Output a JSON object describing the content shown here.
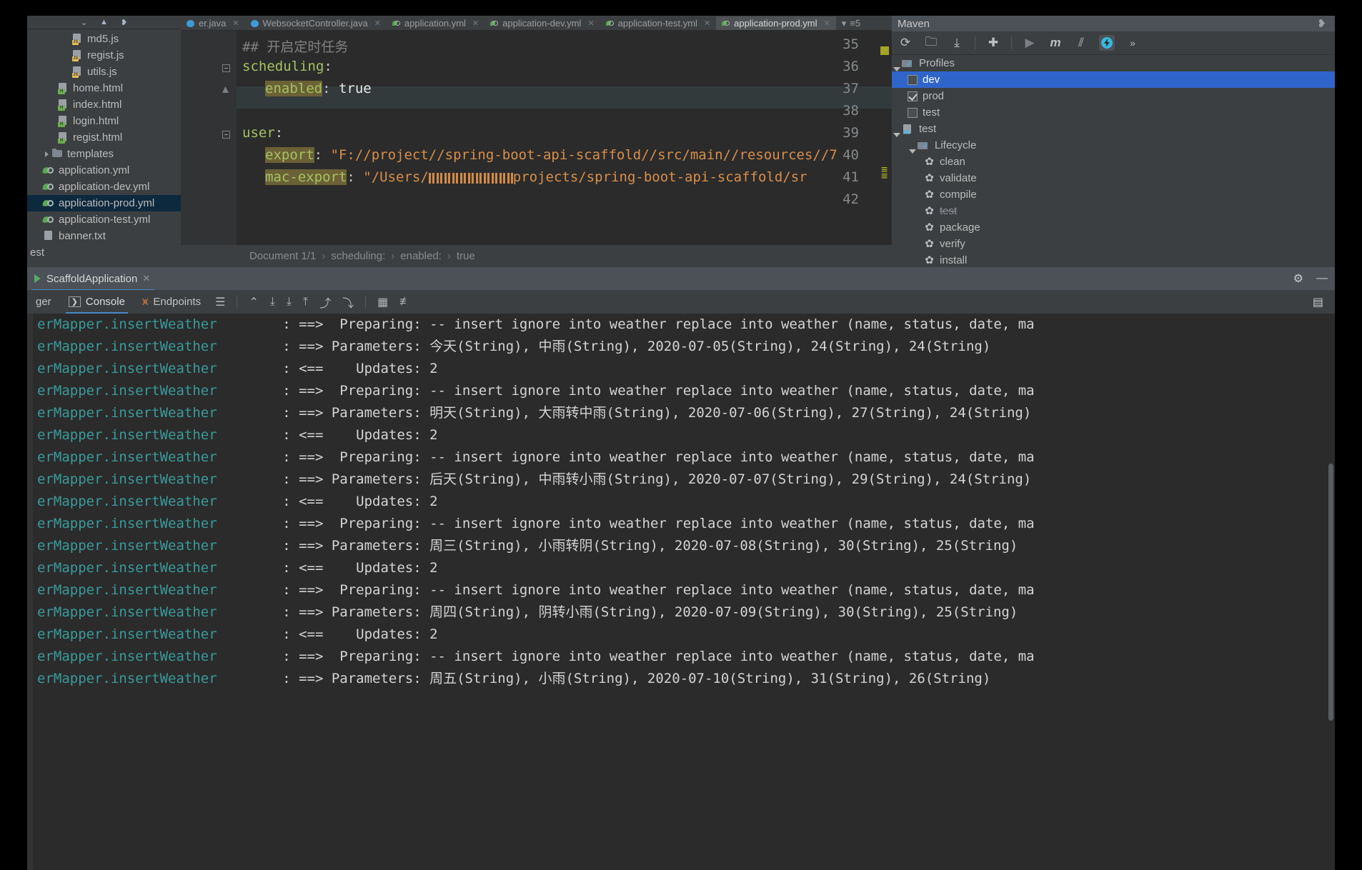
{
  "project_tree": {
    "items": [
      {
        "label": "md5.js",
        "icon": "js-file-icon",
        "indent": 58,
        "kind": "js"
      },
      {
        "label": "regist.js",
        "icon": "js-file-icon",
        "indent": 58,
        "kind": "js"
      },
      {
        "label": "utils.js",
        "icon": "js-file-icon",
        "indent": 58,
        "kind": "js"
      },
      {
        "label": "home.html",
        "icon": "html-file-icon",
        "indent": 38,
        "kind": "html"
      },
      {
        "label": "index.html",
        "icon": "html-file-icon",
        "indent": 38,
        "kind": "html"
      },
      {
        "label": "login.html",
        "icon": "html-file-icon",
        "indent": 38,
        "kind": "html"
      },
      {
        "label": "regist.html",
        "icon": "html-file-icon",
        "indent": 38,
        "kind": "html"
      },
      {
        "label": "templates",
        "icon": "folder-icon",
        "indent": 18,
        "kind": "folder"
      },
      {
        "label": "application.yml",
        "icon": "yaml-file-icon",
        "indent": 18,
        "kind": "yml"
      },
      {
        "label": "application-dev.yml",
        "icon": "yaml-file-icon",
        "indent": 18,
        "kind": "yml"
      },
      {
        "label": "application-prod.yml",
        "icon": "yaml-file-icon",
        "indent": 18,
        "kind": "yml",
        "selected": true
      },
      {
        "label": "application-test.yml",
        "icon": "yaml-file-icon",
        "indent": 18,
        "kind": "yml"
      },
      {
        "label": "banner.txt",
        "icon": "text-file-icon",
        "indent": 18,
        "kind": "txt"
      },
      {
        "label": "est",
        "icon": "none",
        "indent": 0,
        "kind": "none"
      }
    ]
  },
  "editor": {
    "tabs": [
      {
        "label": "er.java",
        "kind": "java"
      },
      {
        "label": "WebsocketController.java",
        "kind": "java"
      },
      {
        "label": "application.yml",
        "kind": "yml"
      },
      {
        "label": "application-dev.yml",
        "kind": "yml"
      },
      {
        "label": "application-test.yml",
        "kind": "yml"
      },
      {
        "label": "application-prod.yml",
        "kind": "yml",
        "active": true
      }
    ],
    "tab_overflow": "5",
    "lines": [
      {
        "num": "35",
        "comment": "## 开启定时任务"
      },
      {
        "num": "36",
        "key": "scheduling",
        "colon": ":",
        "fold": true
      },
      {
        "num": "37",
        "key_hl": "enabled",
        "colon": ": ",
        "value": "true",
        "current": true
      },
      {
        "num": "38"
      },
      {
        "num": "39",
        "key": "user",
        "colon": ":",
        "fold": true
      },
      {
        "num": "40",
        "key_hl": "export",
        "colon": ": ",
        "string": "\"F://project//spring-boot-api-scaffold//src/main//resources//7"
      },
      {
        "num": "41",
        "key_hl": "mac-export",
        "colon": ": ",
        "string_pre": "\"/Users/",
        "redacted": true,
        "string_post": "projects/spring-boot-api-scaffold/sr"
      },
      {
        "num": "42"
      }
    ],
    "breadcrumb": [
      "Document 1/1",
      "scheduling:",
      "enabled:",
      "true"
    ],
    "breadcrumb_sep": "›"
  },
  "maven": {
    "title": "Maven",
    "toolbar_icons": [
      "reload-icon",
      "add-maven-project-icon",
      "download-sources-icon",
      "add-icon",
      "run-icon",
      "maven-goal-icon",
      "toggle-skip-tests-icon",
      "toggle-offline-icon",
      "more-icon"
    ],
    "tree": [
      {
        "label": "Profiles",
        "kind": "profiles-folder",
        "indent": 8,
        "expanded": true
      },
      {
        "label": "dev",
        "kind": "checkbox",
        "checked": false,
        "indent": 30,
        "selected": true
      },
      {
        "label": "prod",
        "kind": "checkbox",
        "checked": true,
        "indent": 30
      },
      {
        "label": "test",
        "kind": "checkbox",
        "checked": false,
        "indent": 30
      },
      {
        "label": "test",
        "kind": "module",
        "indent": 8,
        "expanded": true
      },
      {
        "label": "Lifecycle",
        "kind": "lifecycle-folder",
        "indent": 30,
        "expanded": true
      },
      {
        "label": "clean",
        "kind": "goal",
        "indent": 52
      },
      {
        "label": "validate",
        "kind": "goal",
        "indent": 52
      },
      {
        "label": "compile",
        "kind": "goal",
        "indent": 52
      },
      {
        "label": "test",
        "kind": "goal",
        "indent": 52,
        "struck": true
      },
      {
        "label": "package",
        "kind": "goal",
        "indent": 52
      },
      {
        "label": "verify",
        "kind": "goal",
        "indent": 52
      },
      {
        "label": "install",
        "kind": "goal",
        "indent": 52
      }
    ]
  },
  "run_panel": {
    "tab_label": "ScaffoldApplication",
    "close_glyph": "✕",
    "settings_glyph": "⚙",
    "minimize_glyph": "—",
    "toolbar_tabs": [
      {
        "label": "ger",
        "icon": "debugger-icon"
      },
      {
        "label": "Console",
        "icon": "console-icon",
        "active": true
      },
      {
        "label": "Endpoints",
        "icon": "endpoints-icon"
      }
    ],
    "toolbar_icons": [
      "list-icon",
      "soft-wrap-icon",
      "scroll-to-end-icon",
      "scroll-down-icon",
      "scroll-up-icon",
      "move-up-icon",
      "move-down-icon",
      "print-icon",
      "settings-list-icon"
    ],
    "right_icon": "layout-icon"
  },
  "console": {
    "logger": "erMapper.insertWeather",
    "arrow_out": ": ==>",
    "arrow_in": ": <==",
    "lines": [
      {
        "type": "prepare",
        "text": "  Preparing: -- insert ignore into weather replace into weather (name, status, date, ma"
      },
      {
        "type": "params",
        "text": " Parameters: 今天(String), 中雨(String), 2020-07-05(String), 24(String), 24(String)"
      },
      {
        "type": "updates",
        "text": "    Updates: 2"
      },
      {
        "type": "prepare",
        "text": "  Preparing: -- insert ignore into weather replace into weather (name, status, date, ma"
      },
      {
        "type": "params",
        "text": " Parameters: 明天(String), 大雨转中雨(String), 2020-07-06(String), 27(String), 24(String)"
      },
      {
        "type": "updates",
        "text": "    Updates: 2"
      },
      {
        "type": "prepare",
        "text": "  Preparing: -- insert ignore into weather replace into weather (name, status, date, ma"
      },
      {
        "type": "params",
        "text": " Parameters: 后天(String), 中雨转小雨(String), 2020-07-07(String), 29(String), 24(String)"
      },
      {
        "type": "updates",
        "text": "    Updates: 2"
      },
      {
        "type": "prepare",
        "text": "  Preparing: -- insert ignore into weather replace into weather (name, status, date, ma"
      },
      {
        "type": "params",
        "text": " Parameters: 周三(String), 小雨转阴(String), 2020-07-08(String), 30(String), 25(String)"
      },
      {
        "type": "updates",
        "text": "    Updates: 2"
      },
      {
        "type": "prepare",
        "text": "  Preparing: -- insert ignore into weather replace into weather (name, status, date, ma"
      },
      {
        "type": "params",
        "text": " Parameters: 周四(String), 阴转小雨(String), 2020-07-09(String), 30(String), 25(String)"
      },
      {
        "type": "updates",
        "text": "    Updates: 2"
      },
      {
        "type": "prepare",
        "text": "  Preparing: -- insert ignore into weather replace into weather (name, status, date, ma"
      },
      {
        "type": "params",
        "text": " Parameters: 周五(String), 小雨(String), 2020-07-10(String), 31(String), 26(String)"
      }
    ]
  },
  "colors": {
    "accent_blue": "#2f65ca",
    "tab_underline": "#4a88c7",
    "string_orange": "#d88f4a",
    "key_green": "#a5c261",
    "logger_teal": "#3a9a9a",
    "selection_tree": "#0d293e"
  }
}
